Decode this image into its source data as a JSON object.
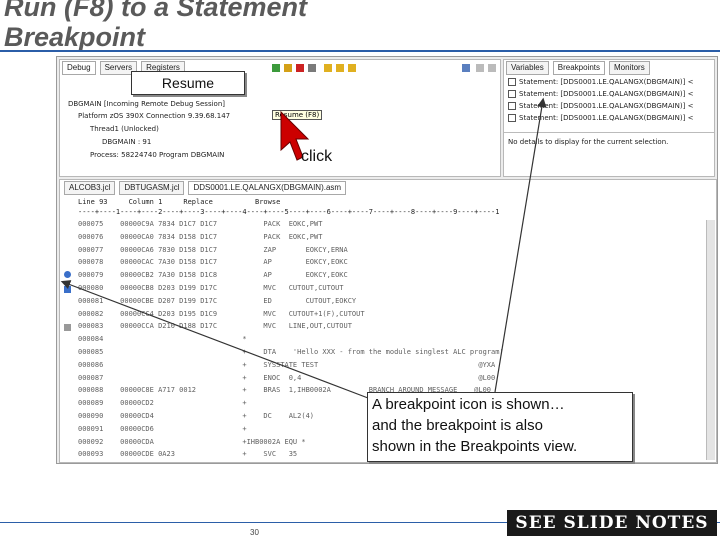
{
  "slide": {
    "title_line1": "Run (F8) to a Statement",
    "title_line2": "Breakpoint",
    "page_number": "30",
    "notes_button": "SEE SLIDE NOTES"
  },
  "callouts": {
    "resume": "Resume",
    "click": "click",
    "info_line1": "A breakpoint icon is shown…",
    "info_line2": "and the breakpoint is also",
    "info_line3": "shown in the Breakpoints view."
  },
  "debug_view": {
    "tabs": [
      "Debug",
      "Servers",
      "Registers"
    ],
    "tooltip": "Resume (F8)",
    "tree": [
      "DBGMAIN [Incoming Remote Debug Session]",
      "Platform zOS 390X  Connection  9.39.68.147",
      "Thread1 (Unlocked)",
      "DBGMAIN : 91",
      "Process: 58224740  Program DBGMAIN"
    ]
  },
  "breakpoints_view": {
    "tabs": [
      "Variables",
      "Breakpoints",
      "Monitors"
    ],
    "rows": [
      "Statement: [DDS0001.LE.QALANGX(DBGMAIN)] <",
      "Statement: [DDS0001.LE.QALANGX(DBGMAIN)] <",
      "Statement: [DDS0001.LE.QALANGX(DBGMAIN)] <",
      "Statement: [DDS0001.LE.QALANGX(DBGMAIN)] <"
    ],
    "details": "No details to display for the current selection."
  },
  "editor": {
    "tabs": [
      "ALCOB3.jcl",
      "DBTUGASM.jcl",
      "DDS0001.LE.QALANGX(DBGMAIN).asm"
    ],
    "status": "Line 93     Column 1     Replace          Browse",
    "ruler": "----+----1----+----2----+----3----+----4----+----5----+----6----+----7----+----8----+----9----+----1",
    "lines": [
      "000075    00000C9A 7834 D1C7 D1C7           PACK  EOKC,PWT",
      "000076    00000CA0 7834 D158 D1C7           PACK  EOKC,PWT",
      "000077    00000CA6 7830 D158 D1C7           ZAP       EOKCY,ERNA",
      "000078    00000CAC 7A30 D158 D1C7           AP        EOKCY,EOKC",
      "000079    00000CB2 7A30 D158 D1C8           AP        EOKCY,EOKC",
      "000080    00000CB8 D203 D199 D17C           MVC   CUTOUT,CUTOUT",
      "000081    00000CBE D207 D199 D17C           ED        CUTOUT,EOKCY",
      "000082    00000CC4 D203 D195 D1C9           MVC   CUTOUT+1(F),CUTOUT",
      "000083    00000CCA D210 D188 D17C           MVC   LINE,OUT,CUTOUT",
      "000084                                 *",
      "000085                                 +    DTA    'Hello XXX - from the module singlest ALC program'",
      "000086                                 +    SYSSTATE TEST                                      @YXA",
      "000087                                 +    ENOC  0,4                                          @L00",
      "000088    00000C8E A717 0012           +    BRAS  1,IHB0002A         BRANCH AROUND MESSAGE    @L00",
      "000089    00000CD2                     +                                                      @YA17138",
      "000090    00000CD4                     +    DC    AL2(4)                                       @L00",
      "000091    00000CD6                     +                                                      program'",
      "000092    00000CDA                     +IHB0002A EQU *                                        @L00",
      "000093    00000CDE 0A23                +    SVC   35                                           @L00"
    ]
  },
  "colors": {
    "title": "#5a5a5a",
    "accent": "#2b5ea8",
    "arrow": "#e8e8e8",
    "cursor": "#cc0000",
    "notes_bg": "#1a1a1a"
  }
}
